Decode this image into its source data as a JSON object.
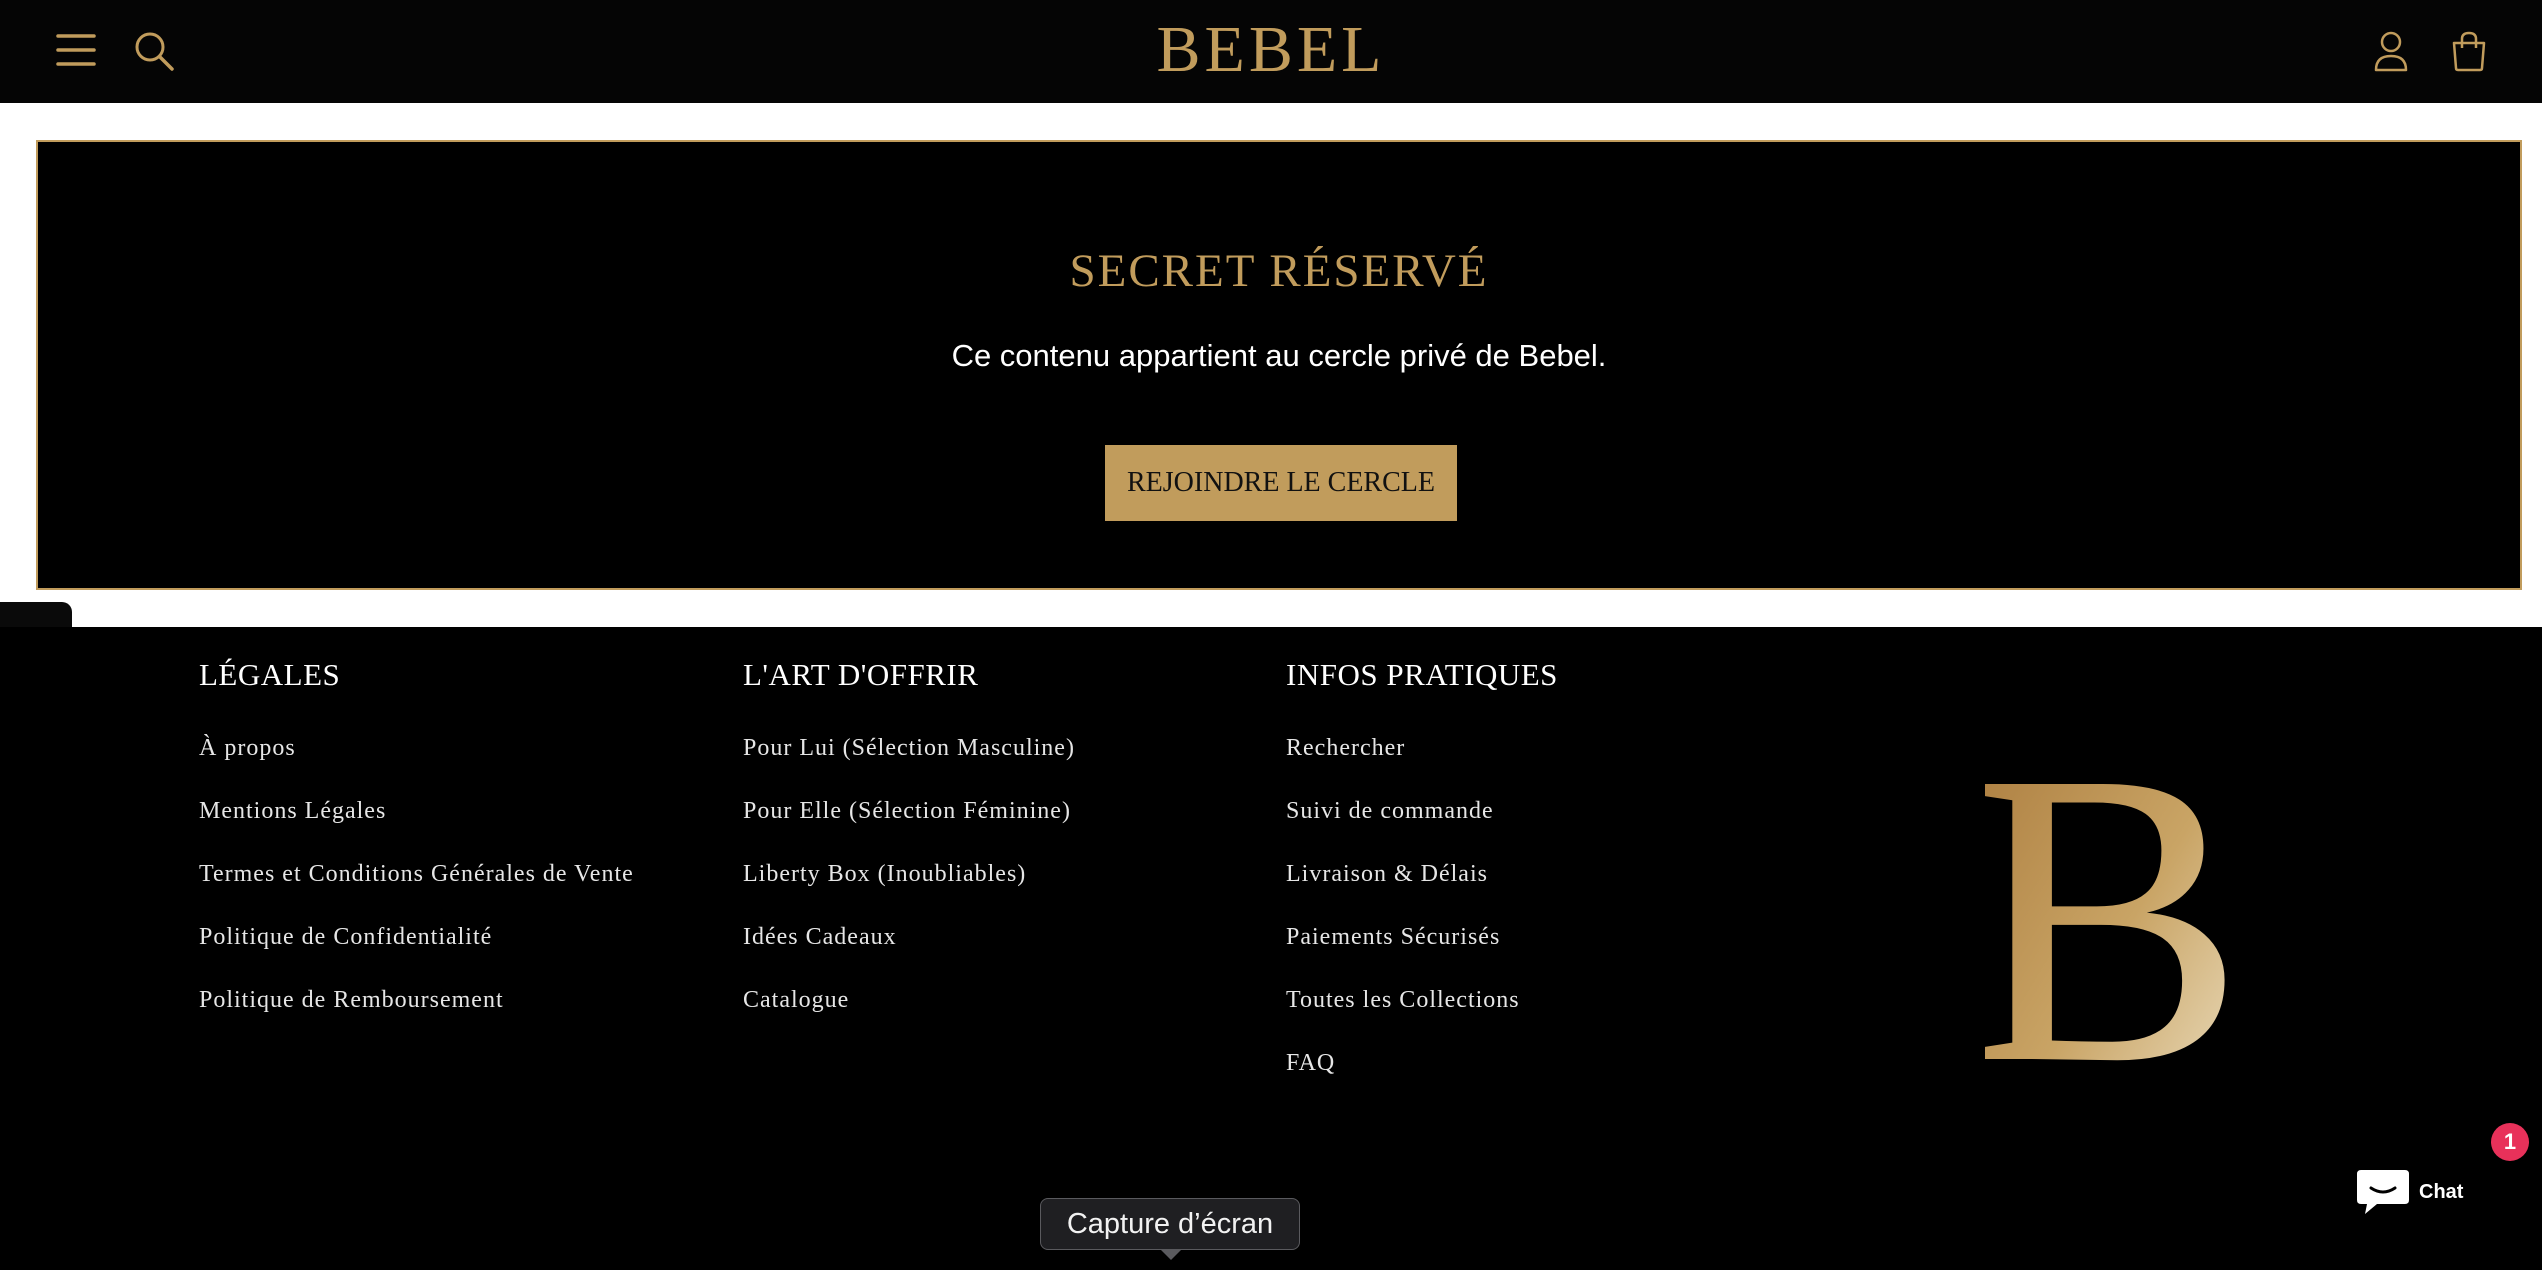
{
  "header": {
    "logo": "BEBEL",
    "accent_color": "#c19c5c",
    "icons": [
      "menu-icon",
      "search-icon",
      "account-icon",
      "cart-icon"
    ]
  },
  "locked": {
    "title": "SECRET RÉSERVÉ",
    "text": "Ce contenu appartient au cercle privé de Bebel.",
    "button": "REJOINDRE LE CERCLE"
  },
  "footer": {
    "columns": [
      {
        "title": "LÉGALES",
        "links": [
          "À propos",
          "Mentions Légales",
          "Termes et Conditions Générales de Vente",
          "Politique de Confidentialité",
          "Politique de Remboursement"
        ]
      },
      {
        "title": "L'ART D'OFFRIR",
        "links": [
          "Pour Lui (Sélection Masculine)",
          "Pour Elle (Sélection Féminine)",
          "Liberty Box (Inoubliables)",
          "Idées Cadeaux",
          "Catalogue"
        ]
      },
      {
        "title": "INFOS PRATIQUES",
        "links": [
          "Rechercher",
          "Suivi de commande",
          "Livraison & Délais",
          "Paiements Sécurisés",
          "Toutes les Collections",
          "FAQ"
        ]
      }
    ],
    "brand_mark": "B"
  },
  "chat": {
    "label": "Chat",
    "badge": "1",
    "badge_color": "#e8315a"
  },
  "tooltip": {
    "text": "Capture d’écran"
  }
}
